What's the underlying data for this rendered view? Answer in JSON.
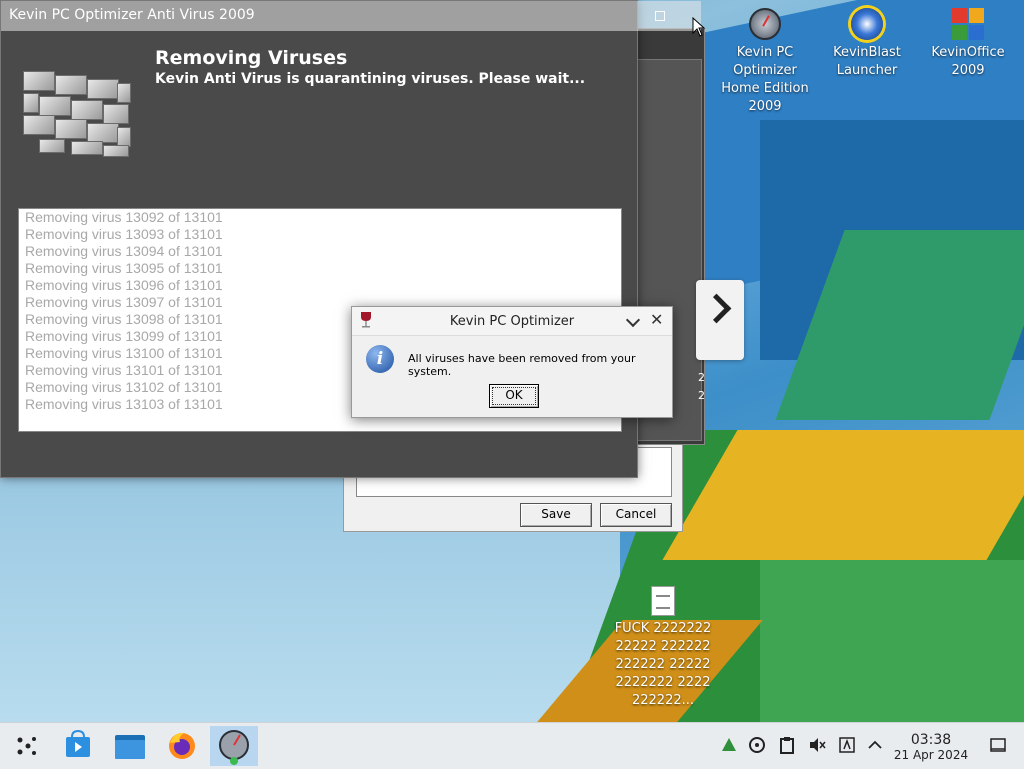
{
  "main_window": {
    "title": "Kevin PC Optimizer Anti Virus 2009",
    "heading": "Removing Viruses",
    "subheading": "Kevin Anti Virus is quarantining viruses. Please wait...",
    "log": [
      "Removing virus 13092 of 13101",
      "Removing virus 13093 of 13101",
      "Removing virus 13094 of 13101",
      "Removing virus 13095 of 13101",
      "Removing virus 13096 of 13101",
      "Removing virus 13097 of 13101",
      "Removing virus 13098 of 13101",
      "Removing virus 13099 of 13101",
      "Removing virus 13100 of 13101",
      "Removing virus 13101 of 13101",
      "Removing virus 13102 of 13101",
      "Removing virus 13103 of 13101"
    ]
  },
  "dialog": {
    "title": "Kevin PC Optimizer",
    "message": "All viruses have been removed from your system.",
    "ok_label": "OK",
    "icon": "info-icon"
  },
  "background_window": {
    "save_label": "Save",
    "cancel_label": "Cancel",
    "partial_digits": "2"
  },
  "desktop_icons": [
    {
      "label": "Kevin PC Optimizer Home Edition 2009",
      "icon": "gauge-icon"
    },
    {
      "label": "KevinBlast Launcher",
      "icon": "blast-icon"
    },
    {
      "label": "KevinOffice 2009",
      "icon": "office-icon"
    },
    {
      "label": "FUCK 222222222222 222222222222 222222222222 2222222222...",
      "icon": "document-icon"
    }
  ],
  "taskbar": {
    "time": "03:38",
    "date": "21 Apr 2024"
  },
  "colors": {
    "accent": "#b8d6ef",
    "window_dark": "#4a4a4a"
  }
}
